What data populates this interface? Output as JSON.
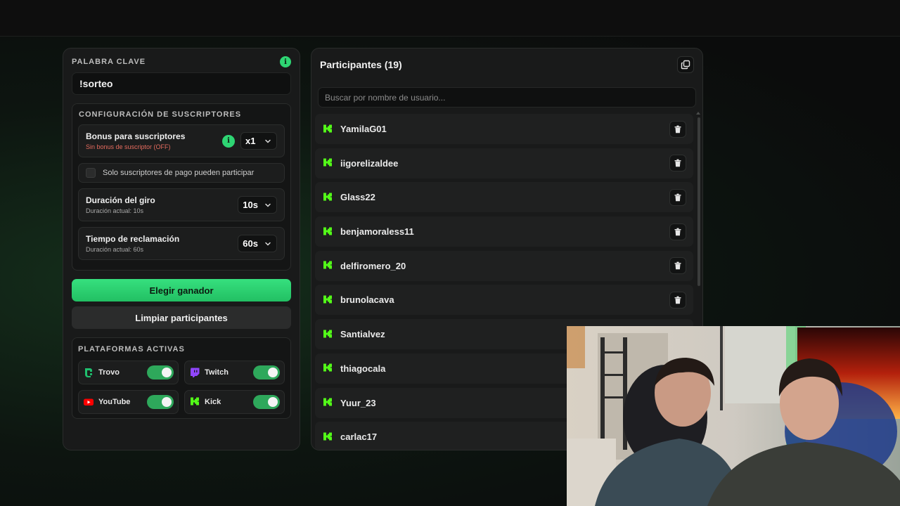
{
  "keyword": {
    "title": "PALABRA CLAVE",
    "value": "!sorteo"
  },
  "subscriber_config": {
    "title": "CONFIGURACIÓN DE SUSCRIPTORES",
    "bonus": {
      "title": "Bonus para suscriptores",
      "subtitle": "Sin bonus de suscriptor (OFF)",
      "value": "x1"
    },
    "paid_only": {
      "label": "Solo suscriptores de pago pueden participar",
      "checked": false
    },
    "spin_duration": {
      "title": "Duración del giro",
      "subtitle": "Duración actual: 10s",
      "value": "10s"
    },
    "claim_time": {
      "title": "Tiempo de reclamación",
      "subtitle": "Duración actual: 60s",
      "value": "60s"
    }
  },
  "actions": {
    "pick_winner": "Elegir ganador",
    "clear_participants": "Limpiar participantes"
  },
  "platforms": {
    "title": "PLATAFORMAS ACTIVAS",
    "items": [
      {
        "name": "Trovo",
        "icon": "trovo-icon",
        "color": "#1fbf6e",
        "enabled": true
      },
      {
        "name": "Twitch",
        "icon": "twitch-icon",
        "color": "#9146ff",
        "enabled": true
      },
      {
        "name": "YouTube",
        "icon": "youtube-icon",
        "color": "#ff0000",
        "enabled": true
      },
      {
        "name": "Kick",
        "icon": "kick-icon",
        "color": "#53fc18",
        "enabled": true
      }
    ]
  },
  "participants": {
    "title": "Participantes (19)",
    "search_placeholder": "Buscar por nombre de usuario...",
    "list": [
      "YamilaG01",
      "iigorelizaldee",
      "Glass22",
      "benjamoraless11",
      "delfiromero_20",
      "brunolacava",
      "Santialvez",
      "thiagocala",
      "Yuur_23",
      "carlac17"
    ]
  },
  "colors": {
    "accent": "#2ed573",
    "kick": "#53fc18",
    "bonus_off": "#e56b5e"
  }
}
